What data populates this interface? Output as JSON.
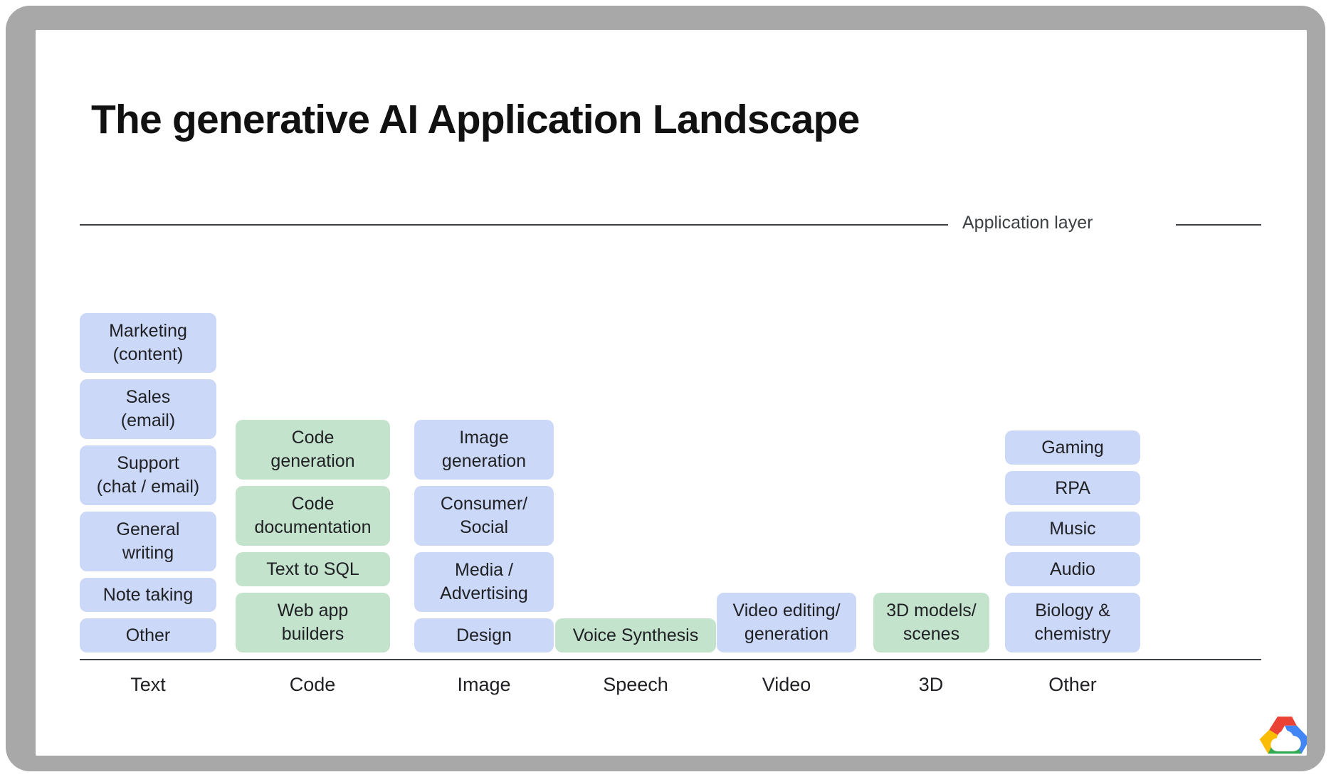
{
  "slide": {
    "title": "The generative AI Application Landscape",
    "layer_label": "Application layer",
    "logo": "google-cloud-logo"
  },
  "chart_data": {
    "type": "table",
    "title": "The generative AI Application Landscape",
    "annotations": [
      "Application layer"
    ],
    "xlabel": "",
    "ylabel": "",
    "grid": false,
    "legend_position": "none",
    "colors": {
      "blue": "#ccd8f8",
      "green": "#c4e3cd",
      "text": "#202124",
      "rule": "#3c4043",
      "bezel": "#a8a8a8",
      "slide": "#ffffff"
    },
    "categories": [
      "Text",
      "Code",
      "Image",
      "Speech",
      "Video",
      "3D",
      "Other"
    ],
    "columns": [
      {
        "category": "Text",
        "items": [
          {
            "label": "Marketing\n(content)",
            "color": "blue",
            "lines": 2
          },
          {
            "label": "Sales\n(email)",
            "color": "blue",
            "lines": 2
          },
          {
            "label": "Support\n(chat / email)",
            "color": "blue",
            "lines": 2
          },
          {
            "label": "General\nwriting",
            "color": "blue",
            "lines": 2
          },
          {
            "label": "Note taking",
            "color": "blue",
            "lines": 1
          },
          {
            "label": "Other",
            "color": "blue",
            "lines": 1
          }
        ]
      },
      {
        "category": "Code",
        "items": [
          {
            "label": "Code\ngeneration",
            "color": "green",
            "lines": 2
          },
          {
            "label": "Code\ndocumentation",
            "color": "green",
            "lines": 2
          },
          {
            "label": "Text to SQL",
            "color": "green",
            "lines": 1
          },
          {
            "label": "Web app\nbuilders",
            "color": "green",
            "lines": 2
          }
        ]
      },
      {
        "category": "Image",
        "items": [
          {
            "label": "Image\ngeneration",
            "color": "blue",
            "lines": 2
          },
          {
            "label": "Consumer/\nSocial",
            "color": "blue",
            "lines": 2
          },
          {
            "label": "Media /\nAdvertising",
            "color": "blue",
            "lines": 2
          },
          {
            "label": "Design",
            "color": "blue",
            "lines": 1
          }
        ]
      },
      {
        "category": "Speech",
        "items": [
          {
            "label": "Voice Synthesis",
            "color": "green",
            "lines": 1
          }
        ]
      },
      {
        "category": "Video",
        "items": [
          {
            "label": "Video editing/\ngeneration",
            "color": "blue",
            "lines": 2
          }
        ]
      },
      {
        "category": "3D",
        "items": [
          {
            "label": "3D models/\nscenes",
            "color": "green",
            "lines": 2
          }
        ]
      },
      {
        "category": "Other",
        "items": [
          {
            "label": "Gaming",
            "color": "blue",
            "lines": 1
          },
          {
            "label": "RPA",
            "color": "blue",
            "lines": 1
          },
          {
            "label": "Music",
            "color": "blue",
            "lines": 1
          },
          {
            "label": "Audio",
            "color": "blue",
            "lines": 1
          },
          {
            "label": "Biology &\nchemistry",
            "color": "blue",
            "lines": 2
          }
        ]
      }
    ]
  }
}
